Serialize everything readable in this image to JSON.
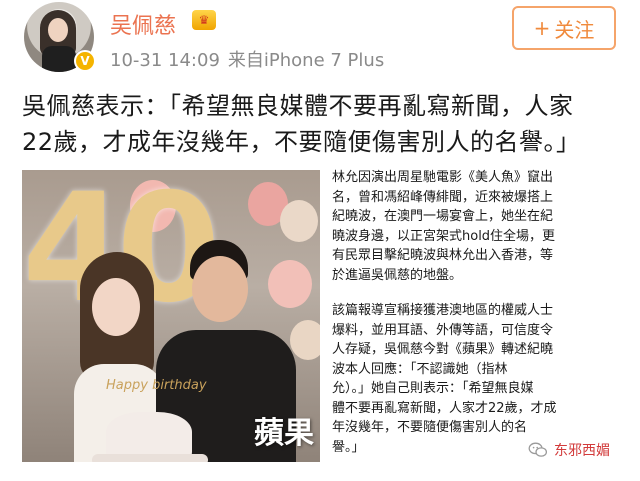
{
  "post": {
    "username": "吴佩慈",
    "timestamp": "10-31 14:09",
    "source": "来自iPhone 7 Plus",
    "follow_label": "关注",
    "follow_plus": "+"
  },
  "headline": {
    "line1": "吳佩慈表示：「希望無良媒體不要再亂寫新聞，人家",
    "line2": "22歲，才成年沒幾年，不要隨便傷害別人的名譽。」"
  },
  "photo": {
    "digits": "40",
    "cake_text": "Happy birthday",
    "watermark": "蘋果"
  },
  "article": {
    "para1": [
      "林允因演出周星馳電影《美人魚》竄出",
      "名，曾和馮紹峰傳緋聞，近來被爆搭上",
      "紀曉波，在澳門一場宴會上，她坐在紀",
      "曉波身邊，以正宮架式hold住全場，更",
      "有民眾目擊紀曉波與林允出入香港，等",
      "於進逼吳佩慈的地盤。"
    ],
    "para2": [
      "該篇報導宣稱接獲港澳地區的權威人士",
      "爆料，並用耳語、外傳等語，可信度令",
      "人存疑，吳佩慈今對《蘋果》轉述紀曉",
      "波本人回應：「不認識她（指林",
      "允）。」她自己則表示：「希望無良媒",
      "體不要再亂寫新聞，人家才22歲，才成",
      "年沒幾年，不要隨便傷害別人的名",
      "譽。」"
    ]
  },
  "source_mark": {
    "label": "东邪西媚"
  },
  "colors": {
    "username": "#eb7350",
    "follow_border": "#f5a46a",
    "follow_text": "#f08a3c",
    "meta_text": "#8a8a8a",
    "source_mark": "#d23a3a"
  },
  "icons": [
    "verified-badge-icon",
    "vip-crown-icon",
    "wechat-icon"
  ]
}
